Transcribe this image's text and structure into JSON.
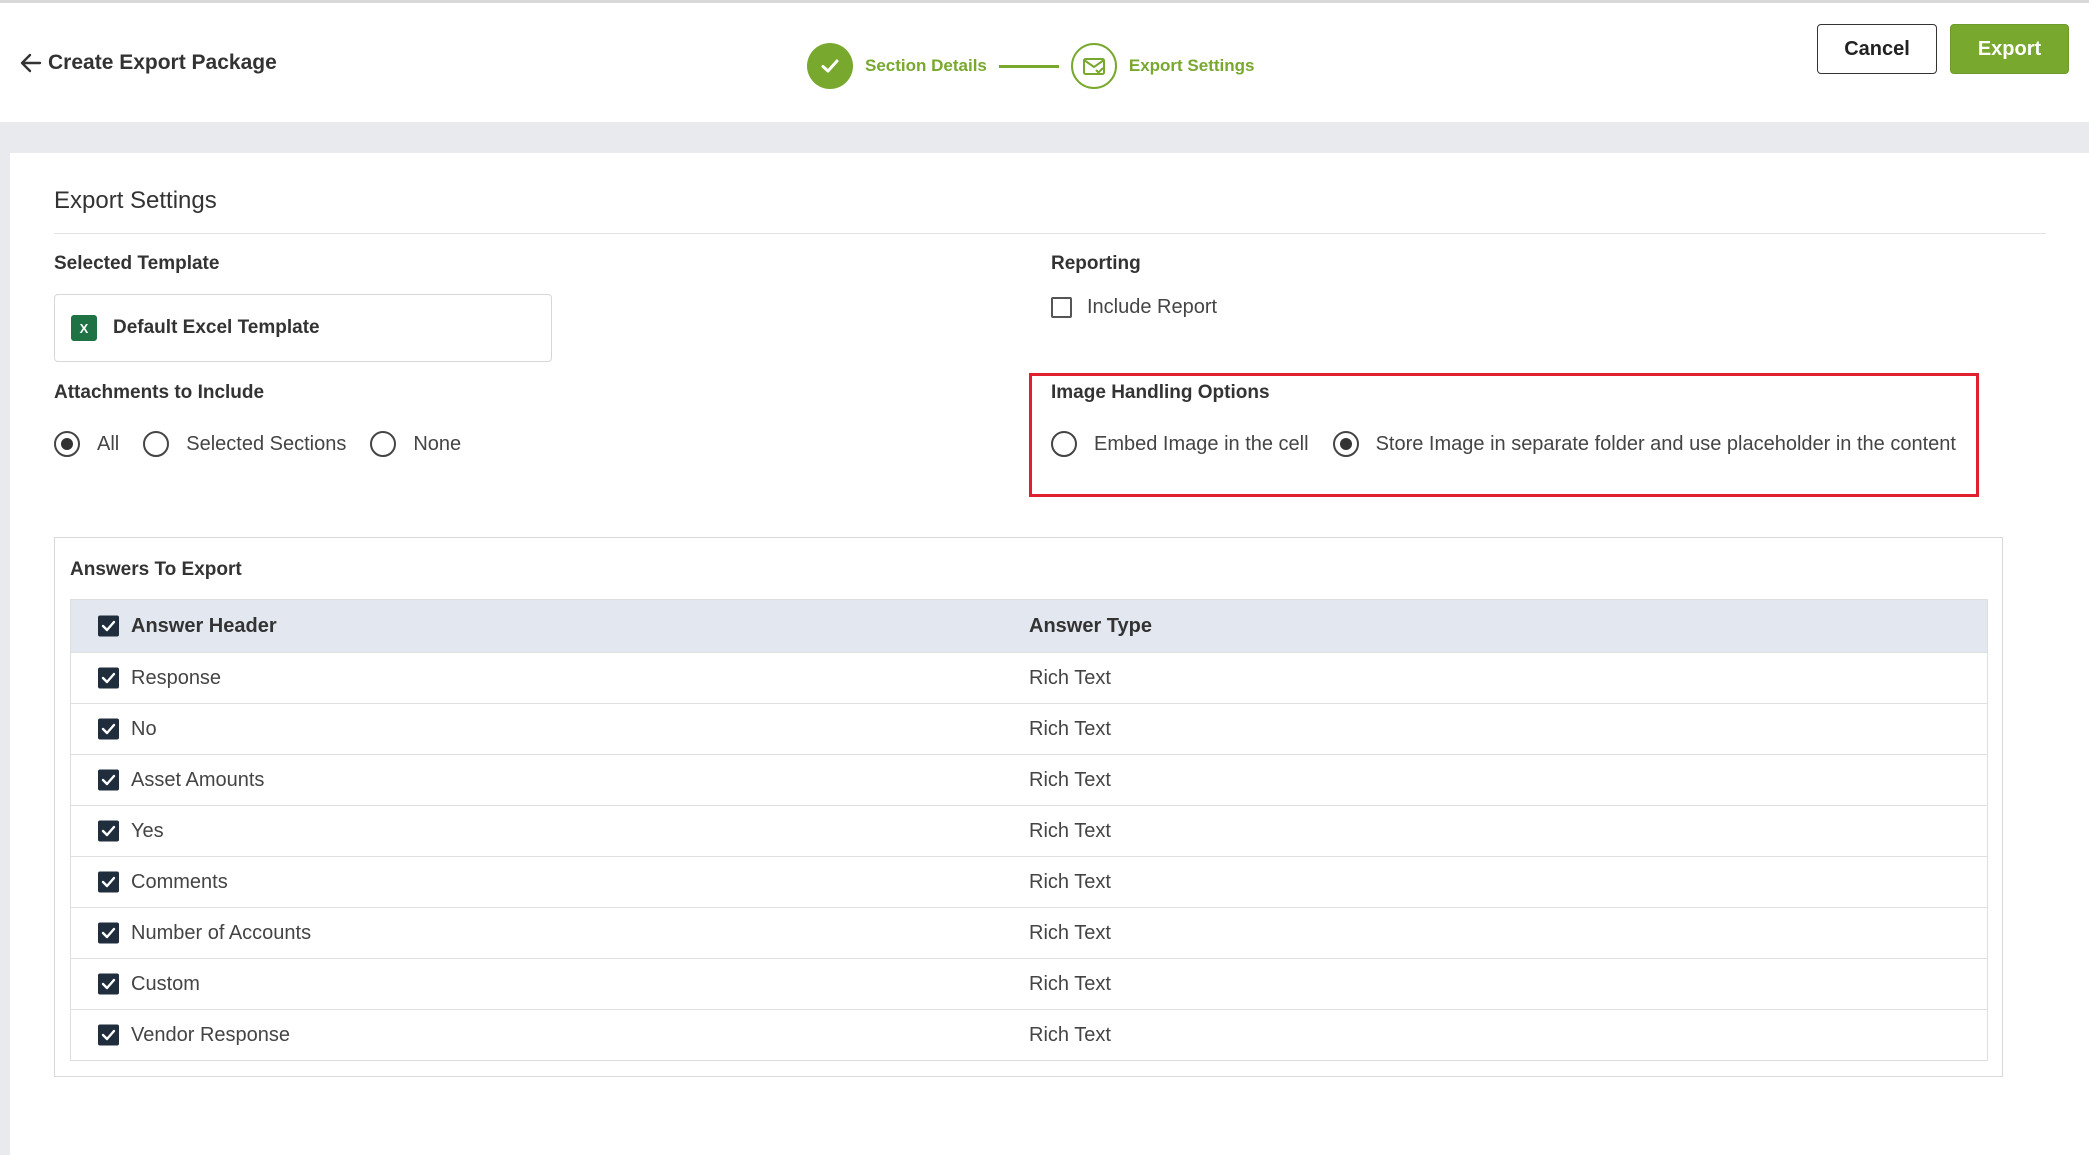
{
  "header": {
    "back_label": "Create Export Package",
    "steps": [
      {
        "label": "Section Details",
        "status": "done"
      },
      {
        "label": "Export Settings",
        "status": "current"
      }
    ],
    "cancel_label": "Cancel",
    "export_label": "Export"
  },
  "settings": {
    "title": "Export Settings",
    "selected_template_label": "Selected Template",
    "template_name": "Default Excel Template",
    "reporting_label": "Reporting",
    "include_report_label": "Include Report",
    "include_report_checked": false,
    "attachments_label": "Attachments to Include",
    "attachment_options": [
      {
        "label": "All",
        "selected": true
      },
      {
        "label": "Selected Sections",
        "selected": false
      },
      {
        "label": "None",
        "selected": false
      }
    ],
    "image_handling_label": "Image Handling Options",
    "image_options": [
      {
        "label": "Embed Image in the cell",
        "selected": false
      },
      {
        "label": "Store Image in separate folder and use placeholder in the content",
        "selected": true
      }
    ]
  },
  "answers": {
    "title": "Answers To Export",
    "columns": [
      "Answer Header",
      "Answer Type"
    ],
    "rows": [
      {
        "header": "Response",
        "type": "Rich Text"
      },
      {
        "header": "No",
        "type": "Rich Text"
      },
      {
        "header": "Asset Amounts",
        "type": "Rich Text"
      },
      {
        "header": "Yes",
        "type": "Rich Text"
      },
      {
        "header": "Comments",
        "type": "Rich Text"
      },
      {
        "header": "Number of Accounts",
        "type": "Rich Text"
      },
      {
        "header": "Custom",
        "type": "Rich Text"
      },
      {
        "header": "Vendor Response",
        "type": "Rich Text"
      }
    ]
  },
  "colors": {
    "accent": "#78a82e",
    "highlight": "#e0202f",
    "checkbox": "#1f2d3d"
  }
}
